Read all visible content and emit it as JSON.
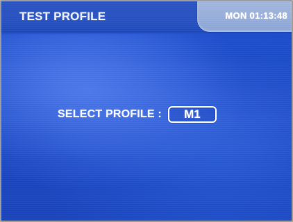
{
  "header": {
    "title": "TEST PROFILE",
    "clock": "MON 01:13:48"
  },
  "main": {
    "select_label": "SELECT PROFILE :",
    "selected_profile": "M1"
  },
  "colors": {
    "background": "#1f4fcf",
    "clock_panel": "#9db2dd",
    "text": "#ffffff"
  }
}
